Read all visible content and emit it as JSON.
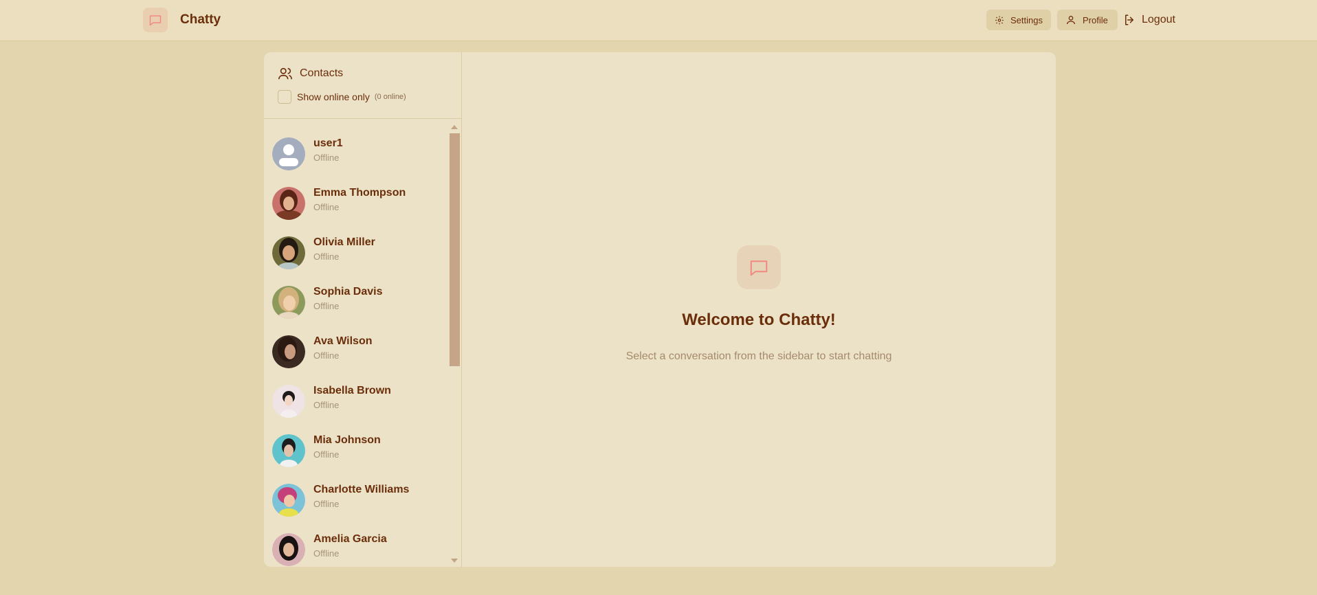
{
  "header": {
    "brand": "Chatty",
    "settings_label": "Settings",
    "profile_label": "Profile",
    "logout_label": "Logout"
  },
  "sidebar": {
    "title": "Contacts",
    "filter_label": "Show online only",
    "online_count": "(0 online)",
    "contacts": [
      {
        "name": "user1",
        "status": "Offline",
        "avatar": "default-avatar"
      },
      {
        "name": "Emma Thompson",
        "status": "Offline",
        "avatar": "photo-avatar"
      },
      {
        "name": "Olivia Miller",
        "status": "Offline",
        "avatar": "photo-avatar"
      },
      {
        "name": "Sophia Davis",
        "status": "Offline",
        "avatar": "photo-avatar"
      },
      {
        "name": "Ava Wilson",
        "status": "Offline",
        "avatar": "photo-avatar"
      },
      {
        "name": "Isabella Brown",
        "status": "Offline",
        "avatar": "photo-avatar"
      },
      {
        "name": "Mia Johnson",
        "status": "Offline",
        "avatar": "photo-avatar"
      },
      {
        "name": "Charlotte Williams",
        "status": "Offline",
        "avatar": "photo-avatar"
      },
      {
        "name": "Amelia Garcia",
        "status": "Offline",
        "avatar": "photo-avatar"
      }
    ]
  },
  "main": {
    "welcome_title": "Welcome to Chatty!",
    "welcome_subtitle": "Select a conversation from the sidebar to start chatting"
  },
  "colors": {
    "page_bg": "#e3d6af",
    "panel_bg": "#ece2c8",
    "text_primary": "#6b2e0b",
    "accent_icon": "#f08a80",
    "scroll_thumb": "#c6a487"
  }
}
